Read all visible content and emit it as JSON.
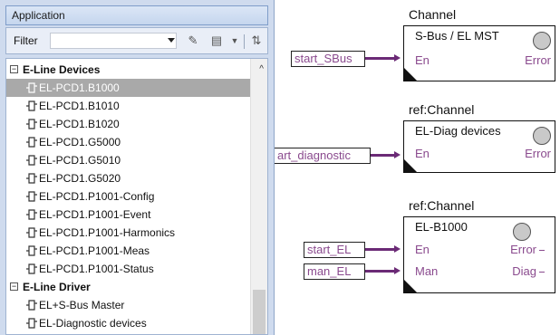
{
  "panel": {
    "title": "Application",
    "filter_label": "Filter",
    "filter_value": "",
    "toolbar_icons": [
      "clear-filter-icon",
      "properties-icon",
      "sort-icon"
    ]
  },
  "tree": {
    "groups": [
      {
        "label": "E-Line Devices",
        "toggle": "−",
        "items": [
          {
            "label": "EL-PCD1.B1000",
            "selected": true
          },
          {
            "label": "EL-PCD1.B1010"
          },
          {
            "label": "EL-PCD1.B1020"
          },
          {
            "label": "EL-PCD1.G5000"
          },
          {
            "label": "EL-PCD1.G5010"
          },
          {
            "label": "EL-PCD1.G5020"
          },
          {
            "label": "EL-PCD1.P1001-Config"
          },
          {
            "label": "EL-PCD1.P1001-Event"
          },
          {
            "label": "EL-PCD1.P1001-Harmonics"
          },
          {
            "label": "EL-PCD1.P1001-Meas"
          },
          {
            "label": "EL-PCD1.P1001-Status"
          }
        ]
      },
      {
        "label": "E-Line Driver",
        "toggle": "−",
        "items": [
          {
            "label": "EL+S-Bus Master"
          },
          {
            "label": "EL-Diagnostic devices"
          }
        ]
      }
    ]
  },
  "canvas": {
    "blocks": [
      {
        "title": "Channel",
        "name": "S-Bus / EL MST",
        "inputs": [
          {
            "pin": "En",
            "source": "start_SBus"
          }
        ],
        "outputs": [
          "Error"
        ]
      },
      {
        "title": "ref:Channel",
        "name": "EL-Diag devices",
        "inputs": [
          {
            "pin": "En",
            "source": "art_diagnostic"
          }
        ],
        "outputs": [
          "Error"
        ]
      },
      {
        "title": "ref:Channel",
        "name": "EL-B1000",
        "inputs": [
          {
            "pin": "En",
            "source": "start_EL"
          },
          {
            "pin": "Man",
            "source": "man_EL"
          }
        ],
        "outputs": [
          "Error",
          "Diag"
        ]
      }
    ]
  },
  "colors": {
    "wire": "#6b2a76",
    "pin_text": "#8a4a8e",
    "panel_bg": "#cfdbee",
    "selection": "#a9a9a9"
  }
}
